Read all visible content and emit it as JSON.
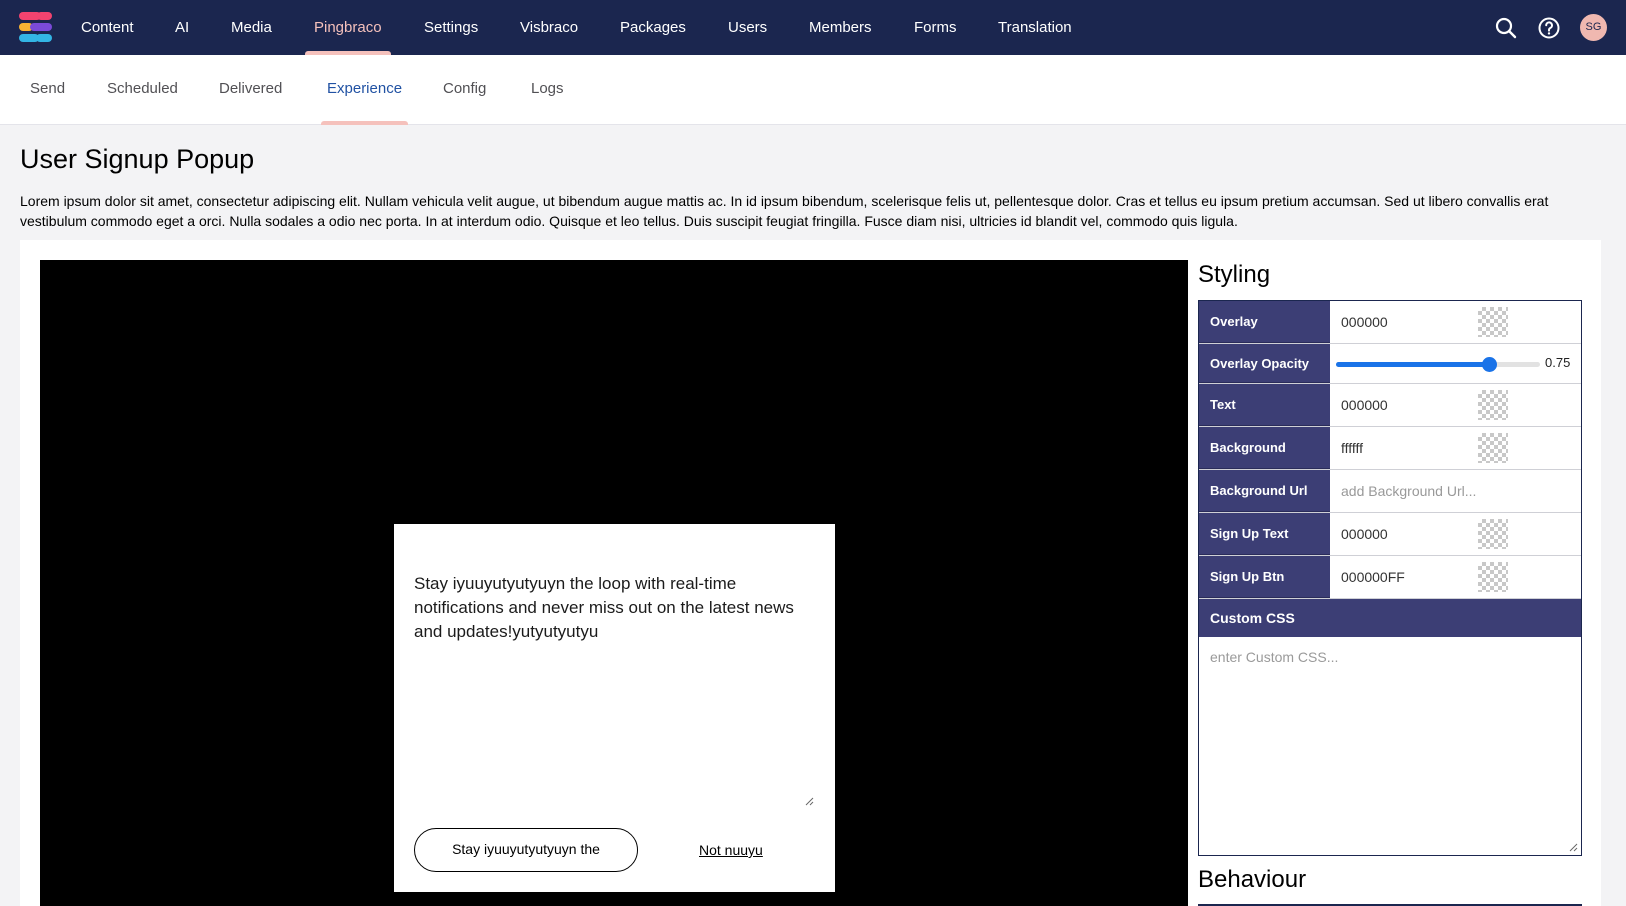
{
  "top_nav": {
    "items": [
      {
        "label": "Content"
      },
      {
        "label": "AI"
      },
      {
        "label": "Media"
      },
      {
        "label": "Pingbraco",
        "active": true
      },
      {
        "label": "Settings"
      },
      {
        "label": "Visbraco"
      },
      {
        "label": "Packages"
      },
      {
        "label": "Users"
      },
      {
        "label": "Members"
      },
      {
        "label": "Forms"
      },
      {
        "label": "Translation"
      }
    ],
    "avatar_initials": "SG",
    "icons": [
      "search-icon",
      "help-icon"
    ],
    "colors": {
      "bar": "#1b264f",
      "active": "#f5c1bc"
    }
  },
  "sub_nav": {
    "tabs": [
      {
        "label": "Send"
      },
      {
        "label": "Scheduled"
      },
      {
        "label": "Delivered"
      },
      {
        "label": "Experience",
        "active": true
      },
      {
        "label": "Config"
      },
      {
        "label": "Logs"
      }
    ]
  },
  "page": {
    "title": "User Signup Popup",
    "description": "Lorem ipsum dolor sit amet, consectetur adipiscing elit. Nullam vehicula velit augue, ut bibendum augue mattis ac. In id ipsum bibendum, scelerisque felis ut, pellentesque dolor. Cras et tellus eu ipsum pretium accumsan. Sed ut libero convallis erat vestibulum commodo eget a orci. Nulla sodales a odio nec porta. In at interdum odio. Quisque et leo tellus. Duis suscipit feugiat fringilla. Fusce diam nisi, ultricies id blandit vel, commodo quis ligula."
  },
  "preview": {
    "popup_text": "Stay iyuuyutyutyuyn the loop with real-time notifications and never miss out on the latest news and updates!yutyutyutyu",
    "signup_button": "Stay iyuuyutyutyuyn the",
    "not_now_link": "Not nuuyu"
  },
  "styling": {
    "title": "Styling",
    "overlay": {
      "label": "Overlay",
      "value": "000000"
    },
    "overlay_opacity": {
      "label": "Overlay Opacity",
      "value": "0.75",
      "level": 0.75
    },
    "text": {
      "label": "Text",
      "value": "000000"
    },
    "background": {
      "label": "Background",
      "value": "ffffff"
    },
    "background_url": {
      "label": "Background Url",
      "placeholder": "add Background Url..."
    },
    "sign_up_text": {
      "label": "Sign Up Text",
      "value": "000000"
    },
    "sign_up_btn": {
      "label": "Sign Up Btn",
      "value": "000000FF"
    },
    "custom_css": {
      "label": "Custom CSS",
      "placeholder": "enter Custom CSS..."
    },
    "label_color": "#3c3e75"
  },
  "behaviour": {
    "title": "Behaviour"
  }
}
